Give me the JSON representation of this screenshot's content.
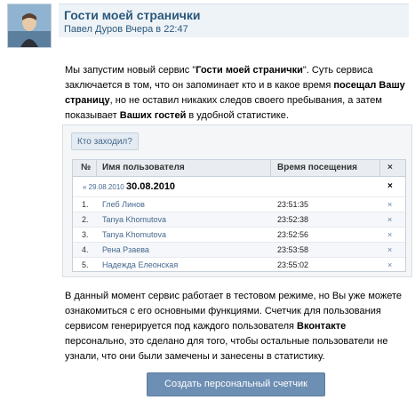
{
  "post": {
    "title": "Гости моей странички",
    "author": "Павел Дуров",
    "date": "Вчера в 22:47"
  },
  "intro": {
    "t1": "Мы запустим новый сервис \"",
    "b1": "Гости моей странички",
    "t2": "\". Суть сервиса заключается в том, что он запоминает кто и в какое время ",
    "b2": "посещал Вашу страницу",
    "t3": ", но не оставил никаких следов своего пребывания, а затем показывает ",
    "b3": "Ваших гостей",
    "t4": " в удобной статистике."
  },
  "widget": {
    "tab_label": "Кто заходил?",
    "headers": {
      "num": "№",
      "user": "Имя пользователя",
      "time": "Время посещения",
      "close": "×"
    },
    "prev_date": "« 29.08.2010",
    "current_date": "30.08.2010",
    "date_close": "×",
    "rows": [
      {
        "num": "1.",
        "user": "Глеб Линов",
        "time": "23:51:35",
        "del": "×"
      },
      {
        "num": "2.",
        "user": "Tanya Khomutova",
        "time": "23:52:38",
        "del": "×"
      },
      {
        "num": "3.",
        "user": "Tanya Khomutova",
        "time": "23:52:56",
        "del": "×"
      },
      {
        "num": "4.",
        "user": "Рена Рзаева",
        "time": "23:53:58",
        "del": "×"
      },
      {
        "num": "5.",
        "user": "Надежда Елеонская",
        "time": "23:55:02",
        "del": "×"
      }
    ]
  },
  "outro": {
    "t1": "В данный момент сервис работает в тестовом режиме, но Вы уже можете ознакомиться с его основными функциями. Счетчик для пользования сервисом генерируется под каждого пользователя ",
    "b1": "Вконтакте",
    "t2": " персонально, это сделано для того, чтобы остальные пользователи не узнали, что они были замечены и занесены в статистику."
  },
  "cta_label": "Создать персональный счетчик",
  "colors": {
    "link": "#2b587a",
    "button": "#6d8fb3",
    "header_bg": "#eef3f8"
  }
}
